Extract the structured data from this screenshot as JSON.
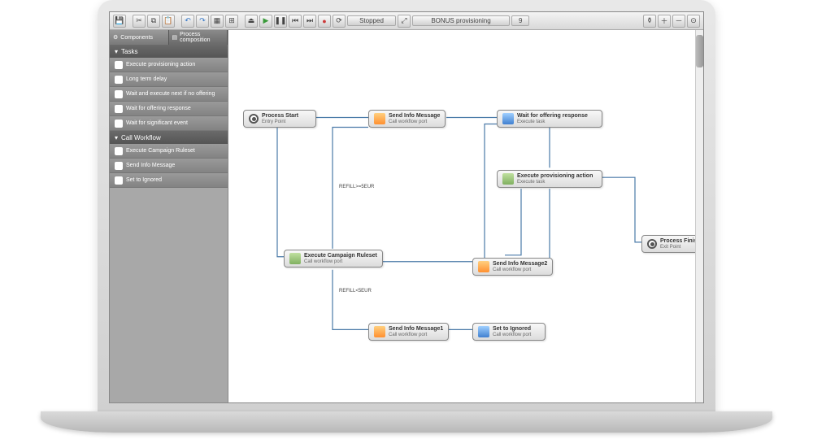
{
  "toolbar": {
    "status": "Stopped",
    "process_name": "BONUS provisioning",
    "zoom": "9"
  },
  "sidebar": {
    "tabs": [
      {
        "label": "Components",
        "active": true
      },
      {
        "label": "Process composition",
        "active": false
      }
    ],
    "sections": [
      {
        "title": "Tasks",
        "items": [
          {
            "label": "Execute provisioning action"
          },
          {
            "label": "Long term delay"
          },
          {
            "label": "Wait and execute next if no offering"
          },
          {
            "label": "Wait for offering response"
          },
          {
            "label": "Wait for significant event"
          }
        ]
      },
      {
        "title": "Call Workflow",
        "items": [
          {
            "label": "Execute Campaign Ruleset"
          },
          {
            "label": "Send Info Message"
          },
          {
            "label": "Set to Ignored"
          }
        ]
      }
    ]
  },
  "nodes": {
    "process_start": {
      "title": "Process Start",
      "subtitle": "Entry Point"
    },
    "send_info": {
      "title": "Send Info Message",
      "subtitle": "Call workflow port"
    },
    "wait_offering": {
      "title": "Wait for offering response",
      "subtitle": "Execute task"
    },
    "exec_prov": {
      "title": "Execute provisioning action",
      "subtitle": "Execute task"
    },
    "exec_campaign": {
      "title": "Execute Campaign Ruleset",
      "subtitle": "Call workflow port"
    },
    "send_info2": {
      "title": "Send Info Message2",
      "subtitle": "Call workflow port"
    },
    "process_finish": {
      "title": "Process Finish",
      "subtitle": "Exit Point"
    },
    "send_info1": {
      "title": "Send Info Message1",
      "subtitle": "Call workflow port"
    },
    "set_ignored": {
      "title": "Set to Ignored",
      "subtitle": "Call workflow port"
    }
  },
  "edge_labels": {
    "refill_ge": "REFILL>=5EUR",
    "refill_lt": "REFILL<5EUR"
  }
}
